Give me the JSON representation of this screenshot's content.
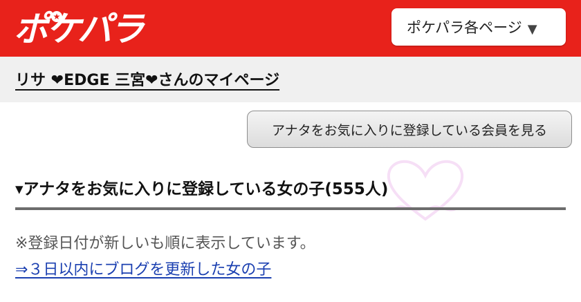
{
  "header": {
    "logo_text": "ポケパラ",
    "page_menu_label": "ポケパラ各ページ",
    "page_menu_arrow": "▼",
    "brand_color": "#e8221b"
  },
  "title_band": {
    "page_title": "リサ ❤EDGE 三宮❤さんのマイページ"
  },
  "main": {
    "fav_button_label": "アナタをお気に入りに登録している会員を見る",
    "section_heading": "▾アナタをお気に入りに登録している女の子(555人)",
    "note": "※登録日付が新しいも順に表示しています。",
    "blog_link": "⇒３日以内にブログを更新した女の子",
    "link_color": "#1a3fb0"
  },
  "icons": {
    "logo_star": "star-icon",
    "dropdown": "triangle-down-icon",
    "watermark": "heart-icon"
  }
}
